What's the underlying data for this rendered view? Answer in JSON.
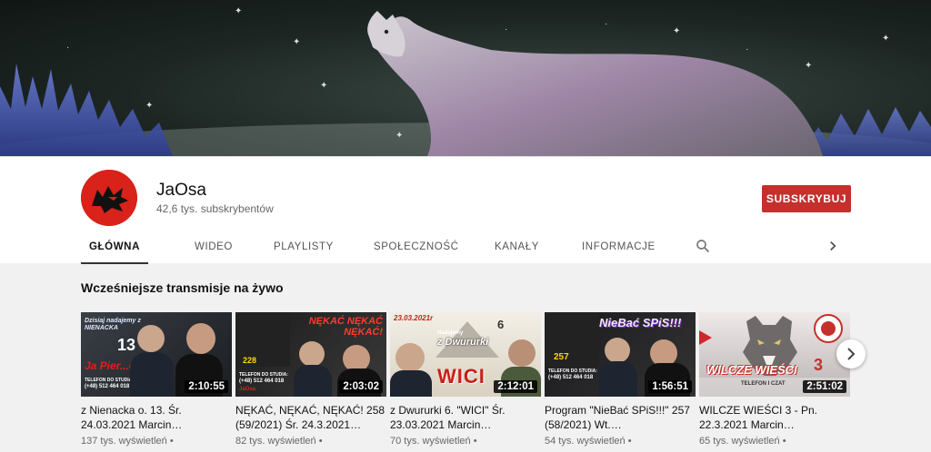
{
  "channel": {
    "name": "JaOsa",
    "subscribers": "42,6 tys. subskrybentów",
    "subscribe_label": "SUBSKRYBUJ"
  },
  "tabs": [
    {
      "label": "GŁÓWNA",
      "active": true
    },
    {
      "label": "WIDEO"
    },
    {
      "label": "PLAYLISTY"
    },
    {
      "label": "SPOŁECZNOŚĆ"
    },
    {
      "label": "KANAŁY"
    },
    {
      "label": "INFORMACJE"
    }
  ],
  "section": {
    "title": "Wcześniejsze transmisje na żywo"
  },
  "videos": [
    {
      "title": "z Nienacka o. 13. Śr. 24.03.2021 Marcin…",
      "views": "137 tys. wyświetleń",
      "duration": "2:10:55",
      "overlay": {
        "top": "Dzisiaj nadajemy z NIENACKA",
        "number": "13",
        "tagline": "Ja Pier...e",
        "phone_label": "TELEFON DO STUDIA:",
        "phone": "(+48) 512 464 018"
      }
    },
    {
      "title": "NĘKAĆ, NĘKAĆ, NĘKAĆ! 258 (59/2021) Śr. 24.3.2021…",
      "views": "82 tys. wyświetleń",
      "duration": "2:03:02",
      "overlay": {
        "headline": "NĘKAĆ NĘKAĆ NĘKAĆ!",
        "number": "228",
        "phone_label": "TELEFON DO STUDIA:",
        "phone": "(+48) 512 464 018",
        "brand": "JaOsa"
      }
    },
    {
      "title": "z Dwururki 6. \"WICI\" Śr. 23.03.2021 Marcin…",
      "views": "70 tys. wyświetleń",
      "duration": "2:12:01",
      "overlay": {
        "date": "23.03.2021r",
        "sub": "Nadajemy",
        "place": "z Dwururki",
        "number": "6",
        "word": "WICI"
      }
    },
    {
      "title": "Program \"NieBać SPiS!!!\" 257 (58/2021) Wt.…",
      "views": "54 tys. wyświetleń",
      "duration": "1:56:51",
      "overlay": {
        "headline": "NieBać SPiS!!!",
        "number": "257",
        "phone_label": "TELEFON DO STUDIA:",
        "phone": "(+48) 512 464 018"
      }
    },
    {
      "title": "WILCZE WIEŚCI 3 - Pn. 22.3.2021 Marcin…",
      "views": "65 tys. wyświetleń",
      "duration": "2:51:02",
      "overlay": {
        "headline": "WILCZE WIEŚCI",
        "number": "3",
        "sub": "TELEFON I CZAT"
      }
    }
  ],
  "colors": {
    "subscribe": "#c4302b",
    "avatar_bg": "#d8221a"
  },
  "icons": [
    "search-icon",
    "chevron-right-icon",
    "wolf-logo-icon"
  ]
}
